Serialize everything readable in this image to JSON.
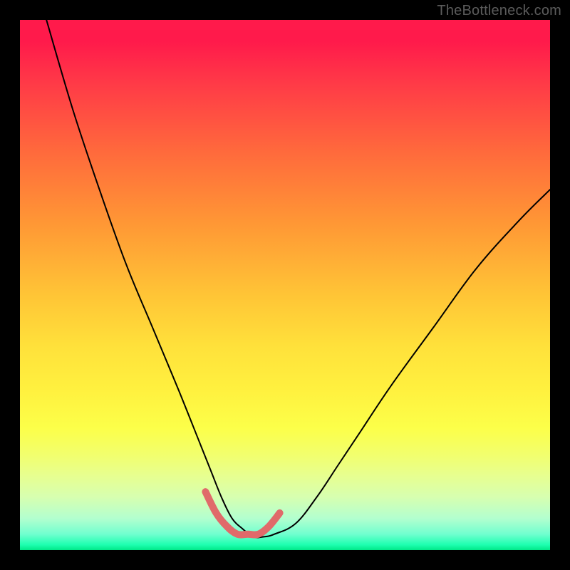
{
  "watermark": "TheBottleneck.com",
  "chart_data": {
    "type": "line",
    "title": "",
    "xlabel": "",
    "ylabel": "",
    "xlim": [
      0,
      100
    ],
    "ylim": [
      0,
      100
    ],
    "series": [
      {
        "name": "black-curve",
        "stroke": "#000000",
        "stroke_width": 2,
        "x": [
          5,
          10,
          15,
          20,
          25,
          30,
          34,
          36,
          38,
          40,
          42,
          44,
          46,
          48,
          52,
          56,
          60,
          64,
          70,
          78,
          86,
          94,
          100
        ],
        "y": [
          100,
          83,
          68,
          54,
          42,
          30,
          20,
          15,
          10,
          6,
          4,
          2.5,
          2.5,
          3,
          5,
          10,
          16,
          22,
          31,
          42,
          53,
          62,
          68
        ]
      },
      {
        "name": "pink-bottom-curve",
        "stroke": "#e06a6a",
        "stroke_width": 10,
        "x": [
          35,
          37,
          39,
          41,
          43,
          45,
          47,
          49
        ],
        "y": [
          11,
          7,
          4.5,
          3,
          3,
          3,
          4.5,
          7
        ]
      }
    ],
    "background_gradient_stops": [
      {
        "pos": 0,
        "color": "#ff1a4b"
      },
      {
        "pos": 50,
        "color": "#ffd23a"
      },
      {
        "pos": 80,
        "color": "#f8ff5a"
      },
      {
        "pos": 100,
        "color": "#00e889"
      }
    ]
  }
}
